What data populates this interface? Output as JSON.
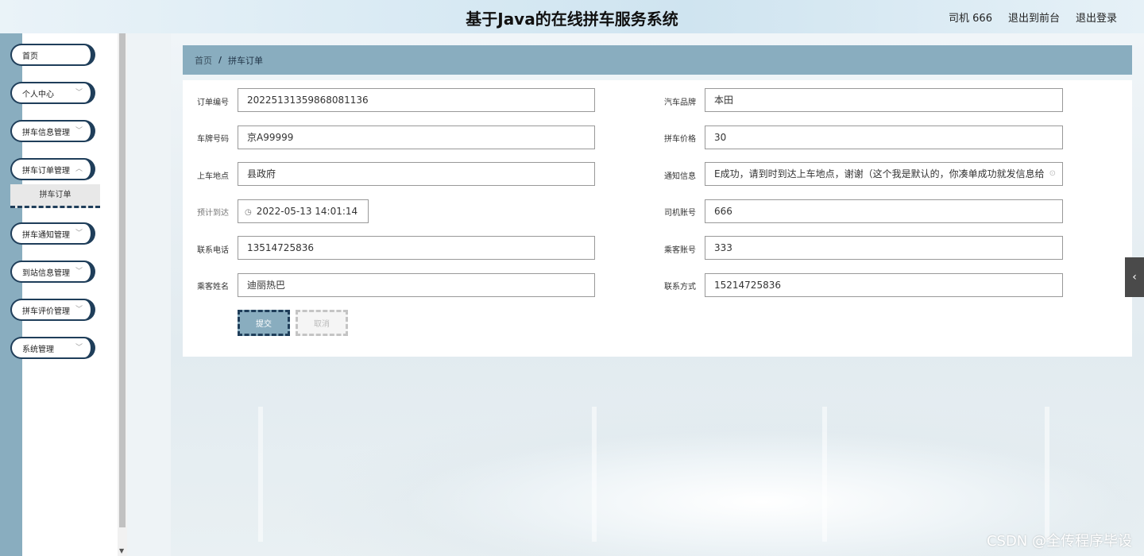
{
  "header": {
    "title": "基于Java的在线拼车服务系统",
    "user": "司机 666",
    "back_to_front": "退出到前台",
    "logout": "退出登录"
  },
  "sidebar": {
    "items": [
      {
        "label": "首页",
        "has_arrow": false
      },
      {
        "label": "个人中心",
        "has_arrow": true
      },
      {
        "label": "拼车信息管理",
        "has_arrow": true
      },
      {
        "label": "拼车订单管理",
        "has_arrow": true
      },
      {
        "label": "拼车通知管理",
        "has_arrow": true
      },
      {
        "label": "到站信息管理",
        "has_arrow": true
      },
      {
        "label": "拼车评价管理",
        "has_arrow": true
      },
      {
        "label": "系统管理",
        "has_arrow": true
      }
    ],
    "active_submenu": "拼车订单"
  },
  "breadcrumb": {
    "home": "首页",
    "separator": "/",
    "current": "拼车订单"
  },
  "form": {
    "order_no": {
      "label": "订单编号",
      "value": "20225131359868081136"
    },
    "car_brand": {
      "label": "汽车品牌",
      "value": "本田"
    },
    "plate_no": {
      "label": "车牌号码",
      "value": "京A99999"
    },
    "price": {
      "label": "拼车价格",
      "value": "30"
    },
    "pickup": {
      "label": "上车地点",
      "value": "县政府"
    },
    "notice": {
      "label": "通知信息",
      "value": "E成功，请到时到达上车地点，谢谢（这个我是默认的，你凑单成功就发信息给"
    },
    "eta": {
      "label": "预计到达",
      "value": "2022-05-13 14:01:14"
    },
    "driver_account": {
      "label": "司机账号",
      "value": "666"
    },
    "phone": {
      "label": "联系电话",
      "value": "13514725836"
    },
    "passenger_account": {
      "label": "乘客账号",
      "value": "333"
    },
    "passenger_name": {
      "label": "乘客姓名",
      "value": "迪丽热巴"
    },
    "contact": {
      "label": "联系方式",
      "value": "15214725836"
    }
  },
  "buttons": {
    "submit": "提交",
    "cancel": "取消"
  },
  "watermark": "CSDN @全传程序毕设",
  "colors": {
    "accent": "#89adbf",
    "dark": "#1f3e5a"
  }
}
